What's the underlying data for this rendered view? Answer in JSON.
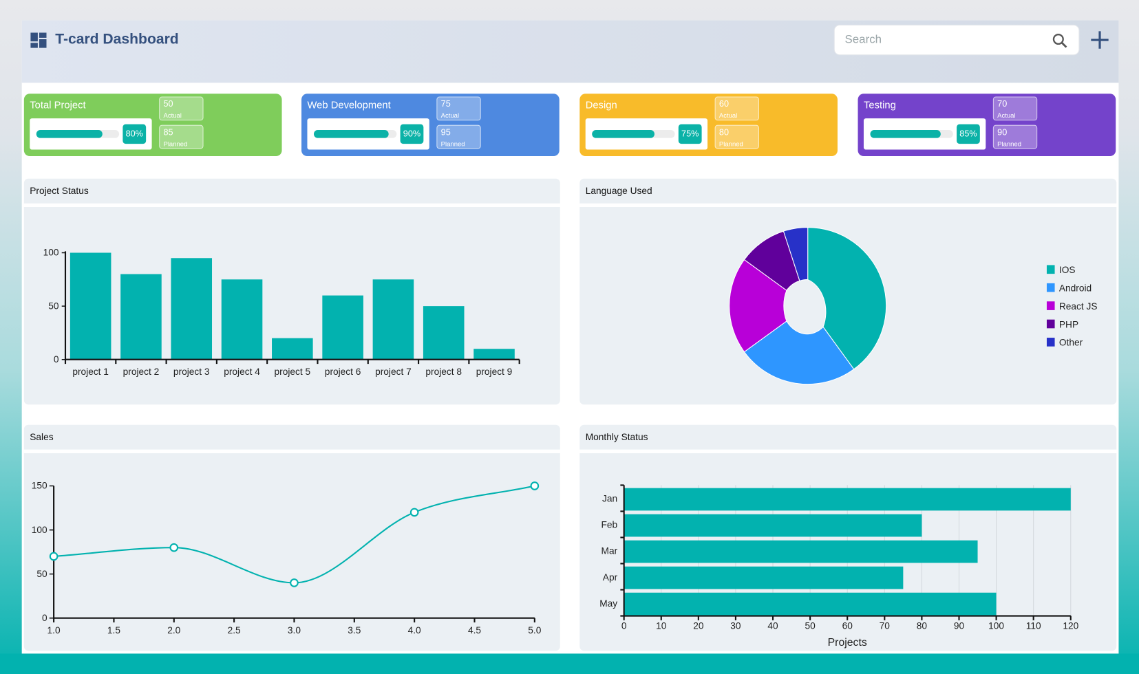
{
  "header": {
    "title": "T-card Dashboard",
    "search_placeholder": "Search",
    "search_value": ""
  },
  "cards": [
    {
      "title": "Total Project",
      "progress_label": "80%",
      "progress": 80,
      "actual_value": "50",
      "actual_label": "Actual",
      "planned_value": "85",
      "planned_label": "Planned",
      "color": "#7fcd5b"
    },
    {
      "title": "Web Development",
      "progress_label": "90%",
      "progress": 90,
      "actual_value": "75",
      "actual_label": "Actual",
      "planned_value": "95",
      "planned_label": "Planned",
      "color": "#4e89e0"
    },
    {
      "title": "Design",
      "progress_label": "75%",
      "progress": 75,
      "actual_value": "60",
      "actual_label": "Actual",
      "planned_value": "80",
      "planned_label": "Planned",
      "color": "#f8bb2a"
    },
    {
      "title": "Testing",
      "progress_label": "85%",
      "progress": 85,
      "actual_value": "70",
      "actual_label": "Actual",
      "planned_value": "90",
      "planned_label": "Planned",
      "color": "#7443cb"
    }
  ],
  "panels": {
    "project_status": "Project Status",
    "language_used": "Language Used",
    "sales": "Sales",
    "monthly_status": "Monthly Status"
  },
  "chart_data": [
    {
      "type": "bar",
      "title": "Project Status",
      "categories": [
        "project 1",
        "project 2",
        "project 3",
        "project 4",
        "project 5",
        "project 6",
        "project 7",
        "project 8",
        "project 9"
      ],
      "values": [
        100,
        80,
        95,
        75,
        20,
        60,
        75,
        50,
        10
      ],
      "ylim": [
        0,
        100
      ],
      "yticks": [
        "0",
        "50",
        "100"
      ],
      "color": "#02b2af",
      "grid": false
    },
    {
      "type": "pie",
      "title": "Language Used",
      "donut": true,
      "labels": [
        "IOS",
        "Android",
        "React JS",
        "PHP",
        "Other"
      ],
      "values": [
        40,
        25,
        20,
        10,
        5
      ],
      "colors": [
        "#02b2af",
        "#2e96ff",
        "#b800d8",
        "#60009b",
        "#2731c8"
      ],
      "legend": "right"
    },
    {
      "type": "line",
      "title": "Sales",
      "x": [
        1,
        2,
        3,
        4,
        5
      ],
      "y": [
        70,
        80,
        40,
        120,
        150
      ],
      "xlim": [
        1,
        5
      ],
      "ylim": [
        0,
        150
      ],
      "xticks": [
        "1.0",
        "1.5",
        "2.0",
        "2.5",
        "3.0",
        "3.5",
        "4.0",
        "4.5",
        "5.0"
      ],
      "yticks": [
        "0",
        "50",
        "100",
        "150"
      ],
      "color": "#02b2af",
      "smooth": true,
      "grid": false
    },
    {
      "type": "bar",
      "orientation": "horizontal",
      "title": "Monthly Status",
      "categories": [
        "Jan",
        "Feb",
        "Mar",
        "Apr",
        "May"
      ],
      "values": [
        120,
        80,
        95,
        75,
        100
      ],
      "xlim": [
        0,
        120
      ],
      "xticks": [
        "0",
        "10",
        "20",
        "30",
        "40",
        "50",
        "60",
        "70",
        "80",
        "90",
        "100",
        "110",
        "120"
      ],
      "xlabel": "Projects",
      "color": "#02b2af",
      "grid": true
    }
  ]
}
